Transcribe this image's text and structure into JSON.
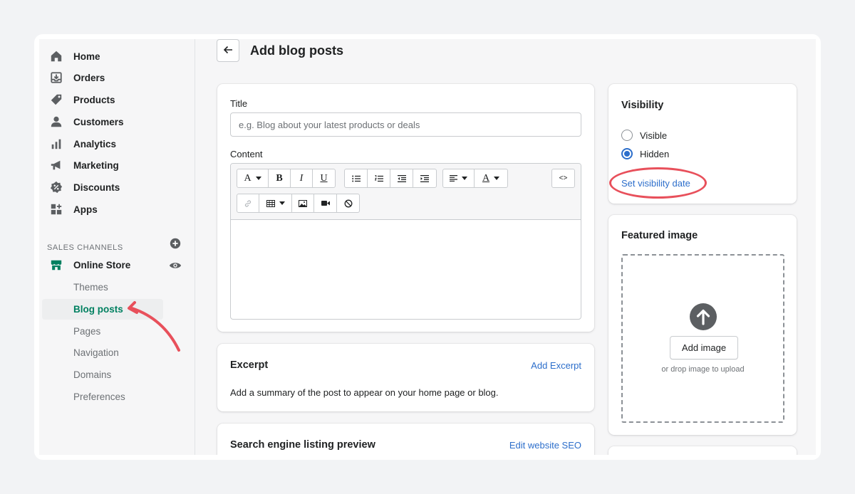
{
  "sidebar": {
    "items": [
      {
        "label": "Home",
        "icon": "home-icon"
      },
      {
        "label": "Orders",
        "icon": "orders-icon"
      },
      {
        "label": "Products",
        "icon": "tag-icon"
      },
      {
        "label": "Customers",
        "icon": "person-icon"
      },
      {
        "label": "Analytics",
        "icon": "bar-chart-icon"
      },
      {
        "label": "Marketing",
        "icon": "megaphone-icon"
      },
      {
        "label": "Discounts",
        "icon": "discount-icon"
      },
      {
        "label": "Apps",
        "icon": "apps-icon"
      }
    ],
    "sales_channels_heading": "SALES CHANNELS",
    "online_store": {
      "label": "Online Store",
      "icon": "store-icon"
    },
    "sub_items": [
      {
        "label": "Themes"
      },
      {
        "label": "Blog posts",
        "active": true
      },
      {
        "label": "Pages"
      },
      {
        "label": "Navigation"
      },
      {
        "label": "Domains"
      },
      {
        "label": "Preferences"
      }
    ]
  },
  "header": {
    "title": "Add blog posts"
  },
  "main": {
    "title_label": "Title",
    "title_placeholder": "e.g. Blog about your latest products or deals",
    "content_label": "Content",
    "toolbar": {
      "font_glyph": "A",
      "bold": "B",
      "italic": "I",
      "underline": "U",
      "color_glyph": "A",
      "code": "<>"
    },
    "excerpt": {
      "title": "Excerpt",
      "action": "Add Excerpt",
      "description": "Add a summary of the post to appear on your home page or blog."
    },
    "seo": {
      "title": "Search engine listing preview",
      "action": "Edit website SEO"
    }
  },
  "visibility": {
    "title": "Visibility",
    "options": [
      {
        "label": "Visible",
        "selected": false
      },
      {
        "label": "Hidden",
        "selected": true
      }
    ],
    "set_date_link": "Set visibility date"
  },
  "featured_image": {
    "title": "Featured image",
    "button": "Add image",
    "hint": "or drop image to upload"
  },
  "colors": {
    "accent": "#2c6ecb",
    "brand_green": "#008060",
    "annotation_red": "#e8505b"
  }
}
